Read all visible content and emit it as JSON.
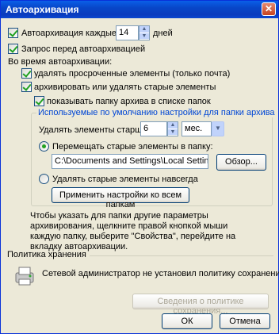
{
  "window": {
    "title": "Автоархивация"
  },
  "autoarchive_every": {
    "label": "Автоархивация каждые",
    "value": "14",
    "unit": "дней"
  },
  "prompt_before": {
    "label": "Запрос перед автоархивацией"
  },
  "during_autoarchive": {
    "label": "Во время автоархивации:"
  },
  "delete_expired": {
    "label": "удалять просроченные элементы (только почта)"
  },
  "archive_or_delete": {
    "label": "архивировать или удалять старые элементы"
  },
  "show_archive_folder": {
    "label": "показывать папку архива в списке папок"
  },
  "defaults_group": {
    "title": "Используемые по умолчанию настройки для папки архива",
    "delete_older_than": {
      "label": "Удалять элементы старше",
      "value": "6",
      "unit": "мес."
    },
    "move_old": {
      "label": "Перемещать старые элементы в папку:",
      "path": "C:\\Documents and Settings\\Local Settings\\A",
      "browse": "Обзор..."
    },
    "delete_permanently": {
      "label": "Удалять старые элементы навсегда"
    },
    "apply_all": "Применить настройки ко всем папкам"
  },
  "hint": "Чтобы указать для папки другие параметры архивирования, щелкните правой кнопкой мыши каждую папку, выберите \"Свойства\", перейдите на вкладку автоархивации.",
  "retention": {
    "title": "Политика хранения",
    "message": "Сетевой администратор не установил политику сохранения.",
    "info_button": "Сведения о политике сохранения..."
  },
  "footer": {
    "ok": "ОК",
    "cancel": "Отмена"
  }
}
